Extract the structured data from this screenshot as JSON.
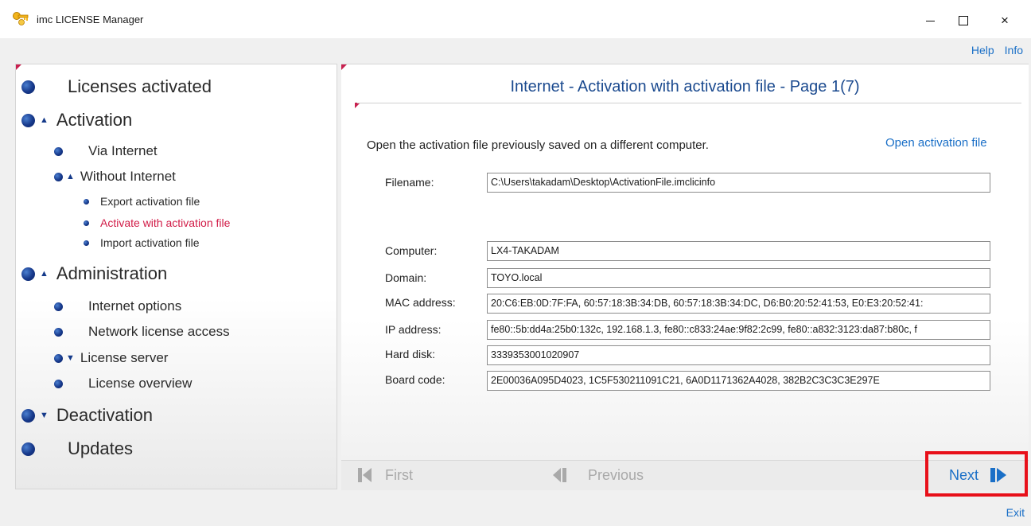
{
  "window": {
    "title": "imc LICENSE Manager",
    "minimize_icon": "minimize-icon",
    "maximize_icon": "maximize-icon",
    "close_glyph": "×"
  },
  "top_links": {
    "help": "Help",
    "info": "Info"
  },
  "nav": {
    "licenses_activated": "Licenses activated",
    "activation": "Activation",
    "via_internet": "Via Internet",
    "without_internet": "Without Internet",
    "export_activation_file": "Export activation file",
    "activate_with_activation_file": "Activate with activation file",
    "import_activation_file": "Import activation file",
    "administration": "Administration",
    "internet_options": "Internet options",
    "network_license_access": "Network license access",
    "license_server": "License server",
    "license_overview": "License overview",
    "deactivation": "Deactivation",
    "updates": "Updates"
  },
  "content": {
    "page_title": "Internet - Activation with activation file - Page 1(7)",
    "description": "Open the activation file previously saved on a different computer.",
    "open_activation_file": "Open activation file",
    "fields": {
      "filename_label": "Filename:",
      "filename_value": "C:\\Users\\takadam\\Desktop\\ActivationFile.imclicinfo",
      "computer_label": "Computer:",
      "computer_value": "LX4-TAKADAM",
      "domain_label": "Domain:",
      "domain_value": "TOYO.local",
      "mac_label": "MAC address:",
      "mac_value": "20:C6:EB:0D:7F:FA, 60:57:18:3B:34:DB, 60:57:18:3B:34:DC, D6:B0:20:52:41:53, E0:E3:20:52:41:",
      "ip_label": "IP address:",
      "ip_value": "fe80::5b:dd4a:25b0:132c, 192.168.1.3, fe80::c833:24ae:9f82:2c99, fe80::a832:3123:da87:b80c, f",
      "hdd_label": "Hard disk:",
      "hdd_value": "3339353001020907",
      "board_label": "Board code:",
      "board_value": "2E00036A095D4023, 1C5F530211091C21, 6A0D1171362A4028, 382B2C3C3C3E297E"
    }
  },
  "pager": {
    "first": "First",
    "previous": "Previous",
    "next": "Next"
  },
  "exit": "Exit",
  "colors": {
    "accent": "#1a6fc7",
    "active_nav": "#d11a46",
    "title_blue": "#1b4a8f",
    "highlight": "#e8101a"
  }
}
